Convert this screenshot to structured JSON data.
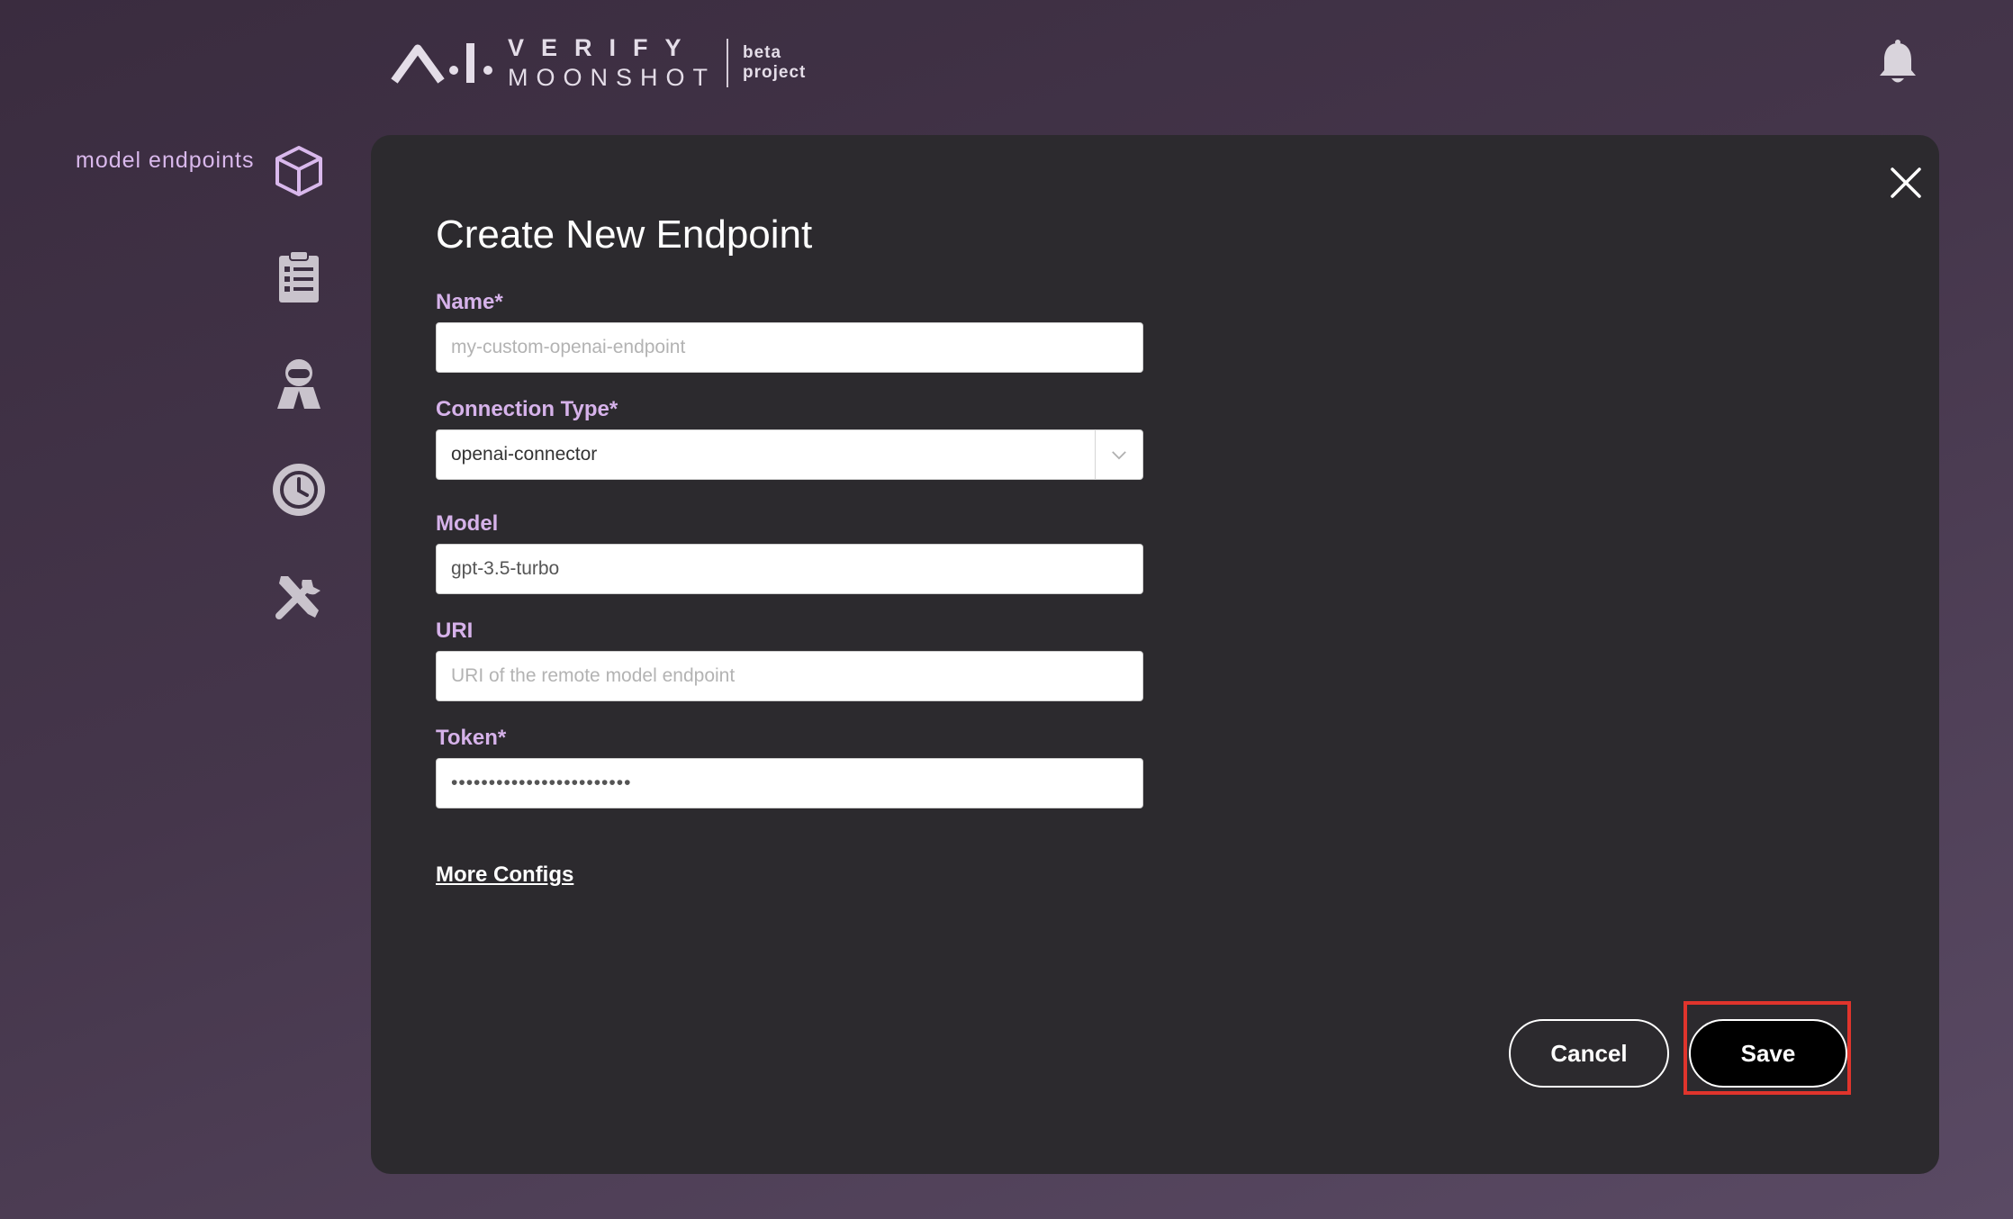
{
  "header": {
    "logo_line1": "VERIFY",
    "logo_line2": "MOONSHOT",
    "logo_tag1": "beta",
    "logo_tag2": "project",
    "bell_icon": "bell-icon"
  },
  "sidebar": {
    "active_label": "model endpoints",
    "items": [
      {
        "icon": "cube-icon",
        "label": "model endpoints"
      },
      {
        "icon": "clipboard-checklist-icon"
      },
      {
        "icon": "red-teaming-icon"
      },
      {
        "icon": "history-icon"
      },
      {
        "icon": "tools-icon"
      }
    ]
  },
  "modal": {
    "title": "Create New Endpoint",
    "fields": {
      "name": {
        "label": "Name*",
        "placeholder": "my-custom-openai-endpoint",
        "value": ""
      },
      "connection_type": {
        "label": "Connection Type*",
        "value": "openai-connector"
      },
      "model": {
        "label": "Model",
        "value": "gpt-3.5-turbo"
      },
      "uri": {
        "label": "URI",
        "placeholder": "URI of the remote model endpoint",
        "value": ""
      },
      "token": {
        "label": "Token*",
        "value": "........................"
      }
    },
    "more_configs": "More Configs",
    "cancel_label": "Cancel",
    "save_label": "Save"
  },
  "colors": {
    "accent": "#d6b2ea",
    "modal_bg": "#2c2a2e",
    "highlight": "#e0342c"
  }
}
